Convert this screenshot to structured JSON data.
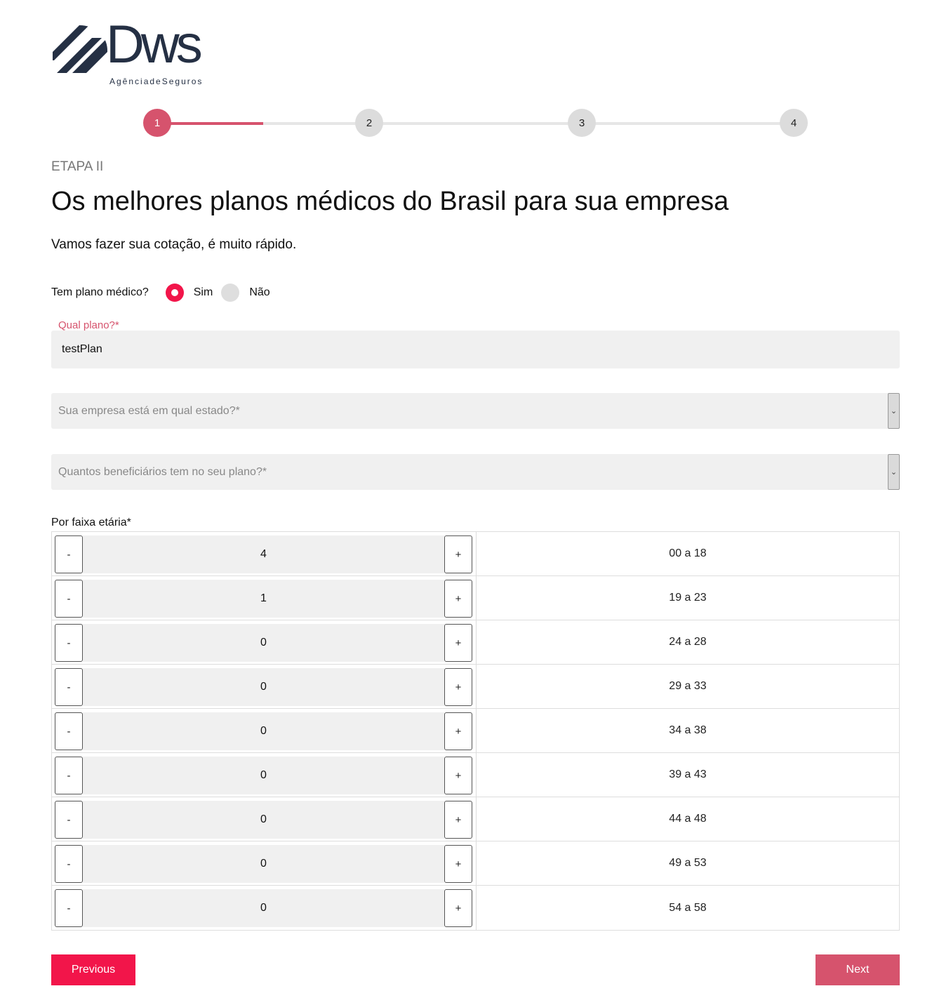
{
  "logo": {
    "word": "Dws",
    "tagline": "AgênciadeSeguros"
  },
  "colors": {
    "accent": "#d6536d",
    "primary": "#f2154a",
    "brand_dark": "#253044"
  },
  "stepper": {
    "steps": [
      "1",
      "2",
      "3",
      "4"
    ],
    "current": 1
  },
  "header": {
    "etapa": "ETAPA II",
    "title": "Os melhores planos médicos do Brasil para sua empresa",
    "subtitle": "Vamos fazer sua cotação, é muito rápido."
  },
  "plan_question": {
    "label": "Tem plano médico?",
    "option_yes": "Sim",
    "option_no": "Não",
    "selected": "Sim"
  },
  "qual_plano": {
    "label": "Qual plano?*",
    "value": "testPlan"
  },
  "estado_select": {
    "placeholder": "Sua empresa está em qual estado?*"
  },
  "beneficiarios_select": {
    "placeholder": "Quantos beneficiários tem no seu plano?*"
  },
  "faixa": {
    "label": "Por faixa etária*",
    "minus_label": "-",
    "plus_label": "+",
    "rows": [
      {
        "count": "4",
        "range": "00 a 18"
      },
      {
        "count": "1",
        "range": "19 a 23"
      },
      {
        "count": "0",
        "range": "24 a 28"
      },
      {
        "count": "0",
        "range": "29 a 33"
      },
      {
        "count": "0",
        "range": "34 a 38"
      },
      {
        "count": "0",
        "range": "39 a 43"
      },
      {
        "count": "0",
        "range": "44 a 48"
      },
      {
        "count": "0",
        "range": "49 a 53"
      },
      {
        "count": "0",
        "range": "54 a 58"
      }
    ]
  },
  "nav": {
    "previous": "Previous",
    "next": "Next"
  }
}
